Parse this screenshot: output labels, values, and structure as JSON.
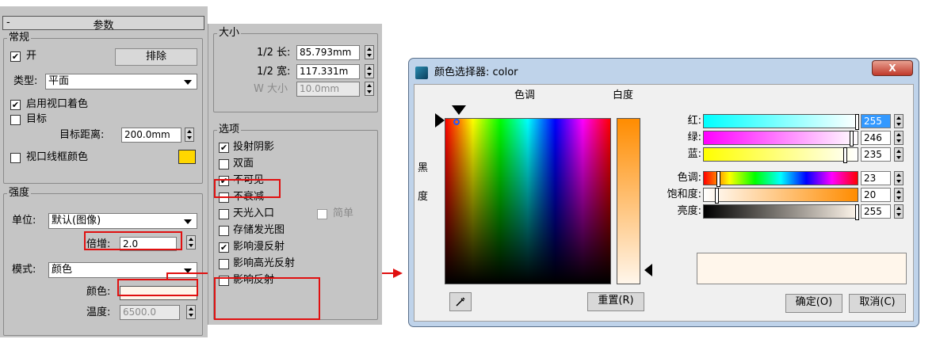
{
  "panel1": {
    "rollout_minus": "-",
    "rollout_title": "参数",
    "general": {
      "label": "常规",
      "on_label": "开",
      "on_checked": true,
      "exclude_button": "排除",
      "type_label": "类型:",
      "type_value": "平面",
      "viewport_shading_label": "启用视口着色",
      "viewport_shading_checked": true,
      "target_label": "目标",
      "target_checked": false,
      "target_distance_label": "目标距离:",
      "target_distance_value": "200.0mm",
      "wireframe_color_label": "视口线框颜色",
      "wireframe_color": "#ffd700"
    },
    "intensity": {
      "label": "强度",
      "unit_label": "单位:",
      "unit_value": "默认(图像)",
      "multiplier_label": "倍增:",
      "multiplier_value": "2.0",
      "mode_label": "模式:",
      "mode_value": "颜色",
      "color_label": "颜色:",
      "color_swatch": "#fff6eb",
      "temperature_label": "温度:",
      "temperature_value": "6500.0"
    }
  },
  "panel2": {
    "size": {
      "label": "大小",
      "half_length_label": "1/2 长:",
      "half_length_value": "85.793mm",
      "half_width_label": "1/2 宽:",
      "half_width_value": "117.331m",
      "w_size_label": "W 大小",
      "w_size_value": "10.0mm"
    },
    "options": {
      "label": "选项",
      "items": [
        {
          "label": "投射阴影",
          "checked": true
        },
        {
          "label": "双面",
          "checked": false
        },
        {
          "label": "不可见",
          "checked": true
        },
        {
          "label": "不衰减",
          "checked": false
        },
        {
          "label": "天光入口",
          "checked": false
        },
        {
          "label": "存储发光图",
          "checked": false
        },
        {
          "label": "影响漫反射",
          "checked": true
        },
        {
          "label": "影响高光反射",
          "checked": false
        },
        {
          "label": "影响反射",
          "checked": false
        }
      ],
      "simple_label": "简单"
    }
  },
  "dialog": {
    "title": "颜色选择器: color",
    "close_glyph": "X",
    "hue_label": "色调",
    "whiteness_label": "白度",
    "blackness_label_1": "黑",
    "blackness_label_2": "度",
    "red_label": "红:",
    "red_value": "255",
    "green_label": "绿:",
    "green_value": "246",
    "blue_label": "蓝:",
    "blue_value": "235",
    "hue2_label": "色调:",
    "hue_value": "23",
    "saturation_label": "饱和度:",
    "saturation_value": "20",
    "brightness_label": "亮度:",
    "brightness_value": "255",
    "reset_button": "重置(R)",
    "ok_button": "确定(O)",
    "cancel_button": "取消(C)",
    "preview_color": "#fff6eb"
  },
  "colors": {
    "highlight_red": "#e01010",
    "selection_blue": "#3399ff"
  }
}
